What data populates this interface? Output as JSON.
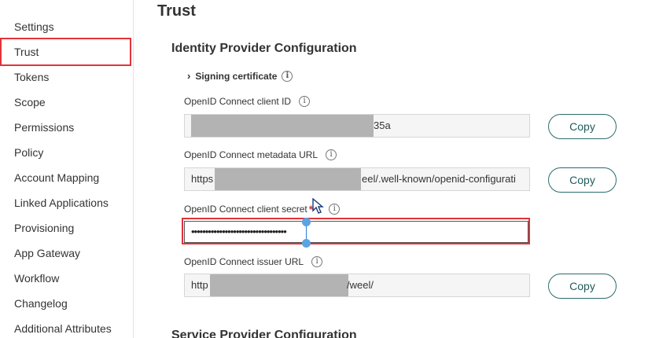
{
  "sidebar": {
    "items": [
      {
        "label": "Settings"
      },
      {
        "label": "Trust"
      },
      {
        "label": "Tokens"
      },
      {
        "label": "Scope"
      },
      {
        "label": "Permissions"
      },
      {
        "label": "Policy"
      },
      {
        "label": "Account Mapping"
      },
      {
        "label": "Linked Applications"
      },
      {
        "label": "Provisioning"
      },
      {
        "label": "App Gateway"
      },
      {
        "label": "Workflow"
      },
      {
        "label": "Changelog"
      },
      {
        "label": "Additional Attributes"
      }
    ],
    "active": "Trust"
  },
  "page": {
    "title": "Trust",
    "section_title": "Identity Provider Configuration",
    "next_section_title": "Service Provider Configuration"
  },
  "signing_certificate": {
    "label": "Signing certificate"
  },
  "fields": {
    "client_id": {
      "label": "OpenID Connect client ID",
      "value_visible": "35a",
      "copy_label": "Copy"
    },
    "metadata_url": {
      "label": "OpenID Connect metadata URL",
      "value_prefix": "https",
      "value_suffix": "eel/.well-known/openid-configurati",
      "copy_label": "Copy"
    },
    "client_secret": {
      "label": "OpenID Connect client secret",
      "required_mark": "*",
      "value": "••••••••••••••••••••••••••••••••••"
    },
    "issuer_url": {
      "label": "OpenID Connect issuer URL",
      "value_prefix": "http",
      "value_suffix": "/weel/",
      "copy_label": "Copy"
    }
  },
  "icons": {
    "info": "info-icon",
    "expand": "chevron-right-icon"
  },
  "colors": {
    "highlight": "#e2333a",
    "button_text": "#1f5b5b",
    "button_border": "#2c6b6b",
    "caret": "#2a7fd4"
  }
}
